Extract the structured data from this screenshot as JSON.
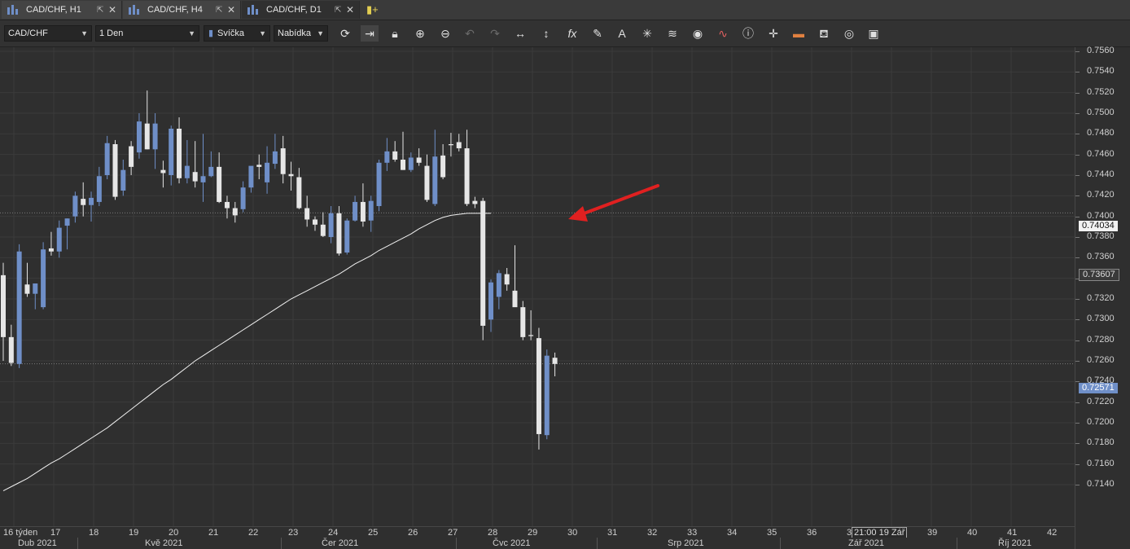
{
  "tabs": [
    {
      "label": "CAD/CHF, H1",
      "active": false
    },
    {
      "label": "CAD/CHF, H4",
      "active": false
    },
    {
      "label": "CAD/CHF, D1",
      "active": true
    }
  ],
  "toolbar": {
    "symbol": "CAD/CHF",
    "period": "1 Den",
    "chart_type": "Svíčka",
    "price_side": "Nabídka",
    "tools": [
      "refresh-icon",
      "autoscroll-icon",
      "lock-icon",
      "zoom-in-icon",
      "zoom-out-icon",
      "undo-icon",
      "redo-icon",
      "horizontal-stretch-icon",
      "vertical-stretch-icon",
      "indicator-fx-icon",
      "pencil-icon",
      "text-icon",
      "pattern-icon",
      "layers-icon",
      "eye-icon",
      "alert-icon",
      "info-icon",
      "crosshair-icon",
      "theme-icon",
      "fill-icon",
      "camera-icon",
      "save-icon"
    ]
  },
  "colors": {
    "bull": "#6f8fc8",
    "bear": "#e6e6e6",
    "ma_line": "#f0f0f0",
    "arrow": "#e02020",
    "grid": "#3b3b3b"
  },
  "y_axis": {
    "ticks": [
      "0.7560",
      "0.7540",
      "0.7520",
      "0.7500",
      "0.7480",
      "0.7460",
      "0.7440",
      "0.7420",
      "0.7400",
      "0.7380",
      "0.7360",
      "0.7340",
      "0.7320",
      "0.7300",
      "0.7280",
      "0.7260",
      "0.7240",
      "0.7220",
      "0.7200",
      "0.7180",
      "0.7160",
      "0.7140"
    ],
    "tags": [
      {
        "text": "0.74034",
        "style": "white"
      },
      {
        "text": "0.73607",
        "style": "dark"
      },
      {
        "text": "0.72571",
        "style": "blue"
      }
    ]
  },
  "x_axis": {
    "weeks": [
      "16 týden",
      "17",
      "18",
      "19",
      "20",
      "21",
      "22",
      "23",
      "24",
      "25",
      "26",
      "27",
      "28",
      "29",
      "30",
      "31",
      "32",
      "33",
      "34",
      "35",
      "36",
      "3",
      "39",
      "40",
      "41",
      "42"
    ],
    "cursor_label": "21:00 19 Zář",
    "months": [
      "Dub 2021",
      "Kvě 2021",
      "Čer 2021",
      "Čvc 2021",
      "Srp 2021",
      "Zář 2021",
      "Říj 2021"
    ]
  },
  "chart_data": {
    "type": "candlestick",
    "symbol": "CAD/CHF",
    "timeframe": "D1",
    "ylim": [
      0.713,
      0.7565
    ],
    "candles": [
      {
        "o": 0.7343,
        "h": 0.7355,
        "l": 0.726,
        "c": 0.7283
      },
      {
        "o": 0.7283,
        "h": 0.7295,
        "l": 0.7255,
        "c": 0.7258
      },
      {
        "o": 0.7257,
        "h": 0.7373,
        "l": 0.7253,
        "c": 0.7366
      },
      {
        "o": 0.7334,
        "h": 0.7355,
        "l": 0.7322,
        "c": 0.7325
      },
      {
        "o": 0.7325,
        "h": 0.7335,
        "l": 0.731,
        "c": 0.7335
      },
      {
        "o": 0.7312,
        "h": 0.7375,
        "l": 0.731,
        "c": 0.7368
      },
      {
        "o": 0.7369,
        "h": 0.7385,
        "l": 0.7362,
        "c": 0.7366
      },
      {
        "o": 0.7366,
        "h": 0.7396,
        "l": 0.736,
        "c": 0.7389
      },
      {
        "o": 0.7391,
        "h": 0.7398,
        "l": 0.7368,
        "c": 0.7398
      },
      {
        "o": 0.74,
        "h": 0.7424,
        "l": 0.7394,
        "c": 0.742
      },
      {
        "o": 0.7417,
        "h": 0.7433,
        "l": 0.74,
        "c": 0.7411
      },
      {
        "o": 0.7411,
        "h": 0.7424,
        "l": 0.7395,
        "c": 0.7418
      },
      {
        "o": 0.7414,
        "h": 0.7448,
        "l": 0.741,
        "c": 0.7439
      },
      {
        "o": 0.744,
        "h": 0.7478,
        "l": 0.7436,
        "c": 0.7471
      },
      {
        "o": 0.747,
        "h": 0.7474,
        "l": 0.7416,
        "c": 0.7419
      },
      {
        "o": 0.7425,
        "h": 0.7455,
        "l": 0.742,
        "c": 0.7445
      },
      {
        "o": 0.7468,
        "h": 0.7473,
        "l": 0.744,
        "c": 0.7448
      },
      {
        "o": 0.7462,
        "h": 0.75,
        "l": 0.7456,
        "c": 0.7492
      },
      {
        "o": 0.749,
        "h": 0.7522,
        "l": 0.7465,
        "c": 0.7465
      },
      {
        "o": 0.7465,
        "h": 0.75,
        "l": 0.7446,
        "c": 0.749
      },
      {
        "o": 0.7445,
        "h": 0.7454,
        "l": 0.7428,
        "c": 0.7442
      },
      {
        "o": 0.744,
        "h": 0.7488,
        "l": 0.743,
        "c": 0.7485
      },
      {
        "o": 0.7485,
        "h": 0.7496,
        "l": 0.7432,
        "c": 0.7437
      },
      {
        "o": 0.7437,
        "h": 0.7474,
        "l": 0.7432,
        "c": 0.7449
      },
      {
        "o": 0.7443,
        "h": 0.7473,
        "l": 0.7428,
        "c": 0.7434
      },
      {
        "o": 0.7433,
        "h": 0.748,
        "l": 0.7414,
        "c": 0.7439
      },
      {
        "o": 0.7439,
        "h": 0.7463,
        "l": 0.7438,
        "c": 0.7448
      },
      {
        "o": 0.7448,
        "h": 0.7462,
        "l": 0.7413,
        "c": 0.7414
      },
      {
        "o": 0.7414,
        "h": 0.742,
        "l": 0.7398,
        "c": 0.7408
      },
      {
        "o": 0.7408,
        "h": 0.7414,
        "l": 0.7394,
        "c": 0.7401
      },
      {
        "o": 0.7407,
        "h": 0.7434,
        "l": 0.7404,
        "c": 0.7428
      },
      {
        "o": 0.7428,
        "h": 0.7448,
        "l": 0.7423,
        "c": 0.7449
      },
      {
        "o": 0.745,
        "h": 0.746,
        "l": 0.7436,
        "c": 0.7448
      },
      {
        "o": 0.7433,
        "h": 0.7468,
        "l": 0.7422,
        "c": 0.7452
      },
      {
        "o": 0.7451,
        "h": 0.748,
        "l": 0.7446,
        "c": 0.7463
      },
      {
        "o": 0.7466,
        "h": 0.7478,
        "l": 0.7432,
        "c": 0.7441
      },
      {
        "o": 0.7441,
        "h": 0.7453,
        "l": 0.7425,
        "c": 0.7439
      },
      {
        "o": 0.7438,
        "h": 0.7447,
        "l": 0.7407,
        "c": 0.7408
      },
      {
        "o": 0.7408,
        "h": 0.742,
        "l": 0.739,
        "c": 0.7397
      },
      {
        "o": 0.7397,
        "h": 0.74,
        "l": 0.7386,
        "c": 0.7392
      },
      {
        "o": 0.7392,
        "h": 0.7404,
        "l": 0.738,
        "c": 0.7381
      },
      {
        "o": 0.738,
        "h": 0.741,
        "l": 0.7374,
        "c": 0.7403
      },
      {
        "o": 0.7403,
        "h": 0.741,
        "l": 0.7362,
        "c": 0.7364
      },
      {
        "o": 0.7365,
        "h": 0.7398,
        "l": 0.7363,
        "c": 0.7396
      },
      {
        "o": 0.7396,
        "h": 0.742,
        "l": 0.7395,
        "c": 0.7414
      },
      {
        "o": 0.7414,
        "h": 0.7432,
        "l": 0.739,
        "c": 0.7395
      },
      {
        "o": 0.7396,
        "h": 0.742,
        "l": 0.7385,
        "c": 0.7415
      },
      {
        "o": 0.741,
        "h": 0.7455,
        "l": 0.7405,
        "c": 0.7452
      },
      {
        "o": 0.7452,
        "h": 0.7476,
        "l": 0.7444,
        "c": 0.7463
      },
      {
        "o": 0.7463,
        "h": 0.7473,
        "l": 0.7453,
        "c": 0.7455
      },
      {
        "o": 0.7455,
        "h": 0.7482,
        "l": 0.7445,
        "c": 0.7445
      },
      {
        "o": 0.7445,
        "h": 0.7462,
        "l": 0.7443,
        "c": 0.7457
      },
      {
        "o": 0.7457,
        "h": 0.7466,
        "l": 0.7449,
        "c": 0.7452
      },
      {
        "o": 0.7449,
        "h": 0.746,
        "l": 0.7414,
        "c": 0.7416
      },
      {
        "o": 0.7412,
        "h": 0.7484,
        "l": 0.741,
        "c": 0.7458
      },
      {
        "o": 0.7459,
        "h": 0.747,
        "l": 0.7436,
        "c": 0.7438
      },
      {
        "o": 0.747,
        "h": 0.7481,
        "l": 0.7458,
        "c": 0.7469
      },
      {
        "o": 0.7472,
        "h": 0.748,
        "l": 0.7463,
        "c": 0.7466
      },
      {
        "o": 0.7466,
        "h": 0.7484,
        "l": 0.741,
        "c": 0.7412
      },
      {
        "o": 0.7415,
        "h": 0.7419,
        "l": 0.7408,
        "c": 0.7412
      },
      {
        "o": 0.7415,
        "h": 0.7418,
        "l": 0.728,
        "c": 0.7294
      },
      {
        "o": 0.73,
        "h": 0.7339,
        "l": 0.7288,
        "c": 0.7336
      },
      {
        "o": 0.7322,
        "h": 0.7348,
        "l": 0.731,
        "c": 0.7345
      },
      {
        "o": 0.7344,
        "h": 0.735,
        "l": 0.7328,
        "c": 0.7334
      },
      {
        "o": 0.7328,
        "h": 0.7372,
        "l": 0.7316,
        "c": 0.7312
      },
      {
        "o": 0.7312,
        "h": 0.7318,
        "l": 0.728,
        "c": 0.7283
      },
      {
        "o": 0.7285,
        "h": 0.7309,
        "l": 0.728,
        "c": 0.7284
      },
      {
        "o": 0.7282,
        "h": 0.7292,
        "l": 0.7174,
        "c": 0.7189
      },
      {
        "o": 0.7188,
        "h": 0.7271,
        "l": 0.7184,
        "c": 0.7265
      },
      {
        "o": 0.7263,
        "h": 0.7268,
        "l": 0.7245,
        "c": 0.7257
      }
    ],
    "moving_average": [
      0.7134,
      0.7138,
      0.7142,
      0.7146,
      0.7151,
      0.7156,
      0.7161,
      0.7165,
      0.717,
      0.7175,
      0.718,
      0.7185,
      0.719,
      0.7195,
      0.7201,
      0.7207,
      0.7213,
      0.7219,
      0.7225,
      0.7231,
      0.7237,
      0.7242,
      0.7248,
      0.7254,
      0.726,
      0.7265,
      0.727,
      0.7275,
      0.728,
      0.7285,
      0.729,
      0.7295,
      0.73,
      0.7305,
      0.731,
      0.7315,
      0.732,
      0.7324,
      0.7328,
      0.7332,
      0.7336,
      0.734,
      0.7344,
      0.7349,
      0.7354,
      0.7358,
      0.7362,
      0.7367,
      0.7371,
      0.7375,
      0.7379,
      0.7383,
      0.7388,
      0.7392,
      0.7396,
      0.7399,
      0.7401,
      0.7402,
      0.7403,
      0.7403,
      0.7403,
      0.7403
    ],
    "horizontal_lines": [
      0.74034,
      0.72571
    ],
    "annotation": "arrow pointing to moving-average end"
  }
}
